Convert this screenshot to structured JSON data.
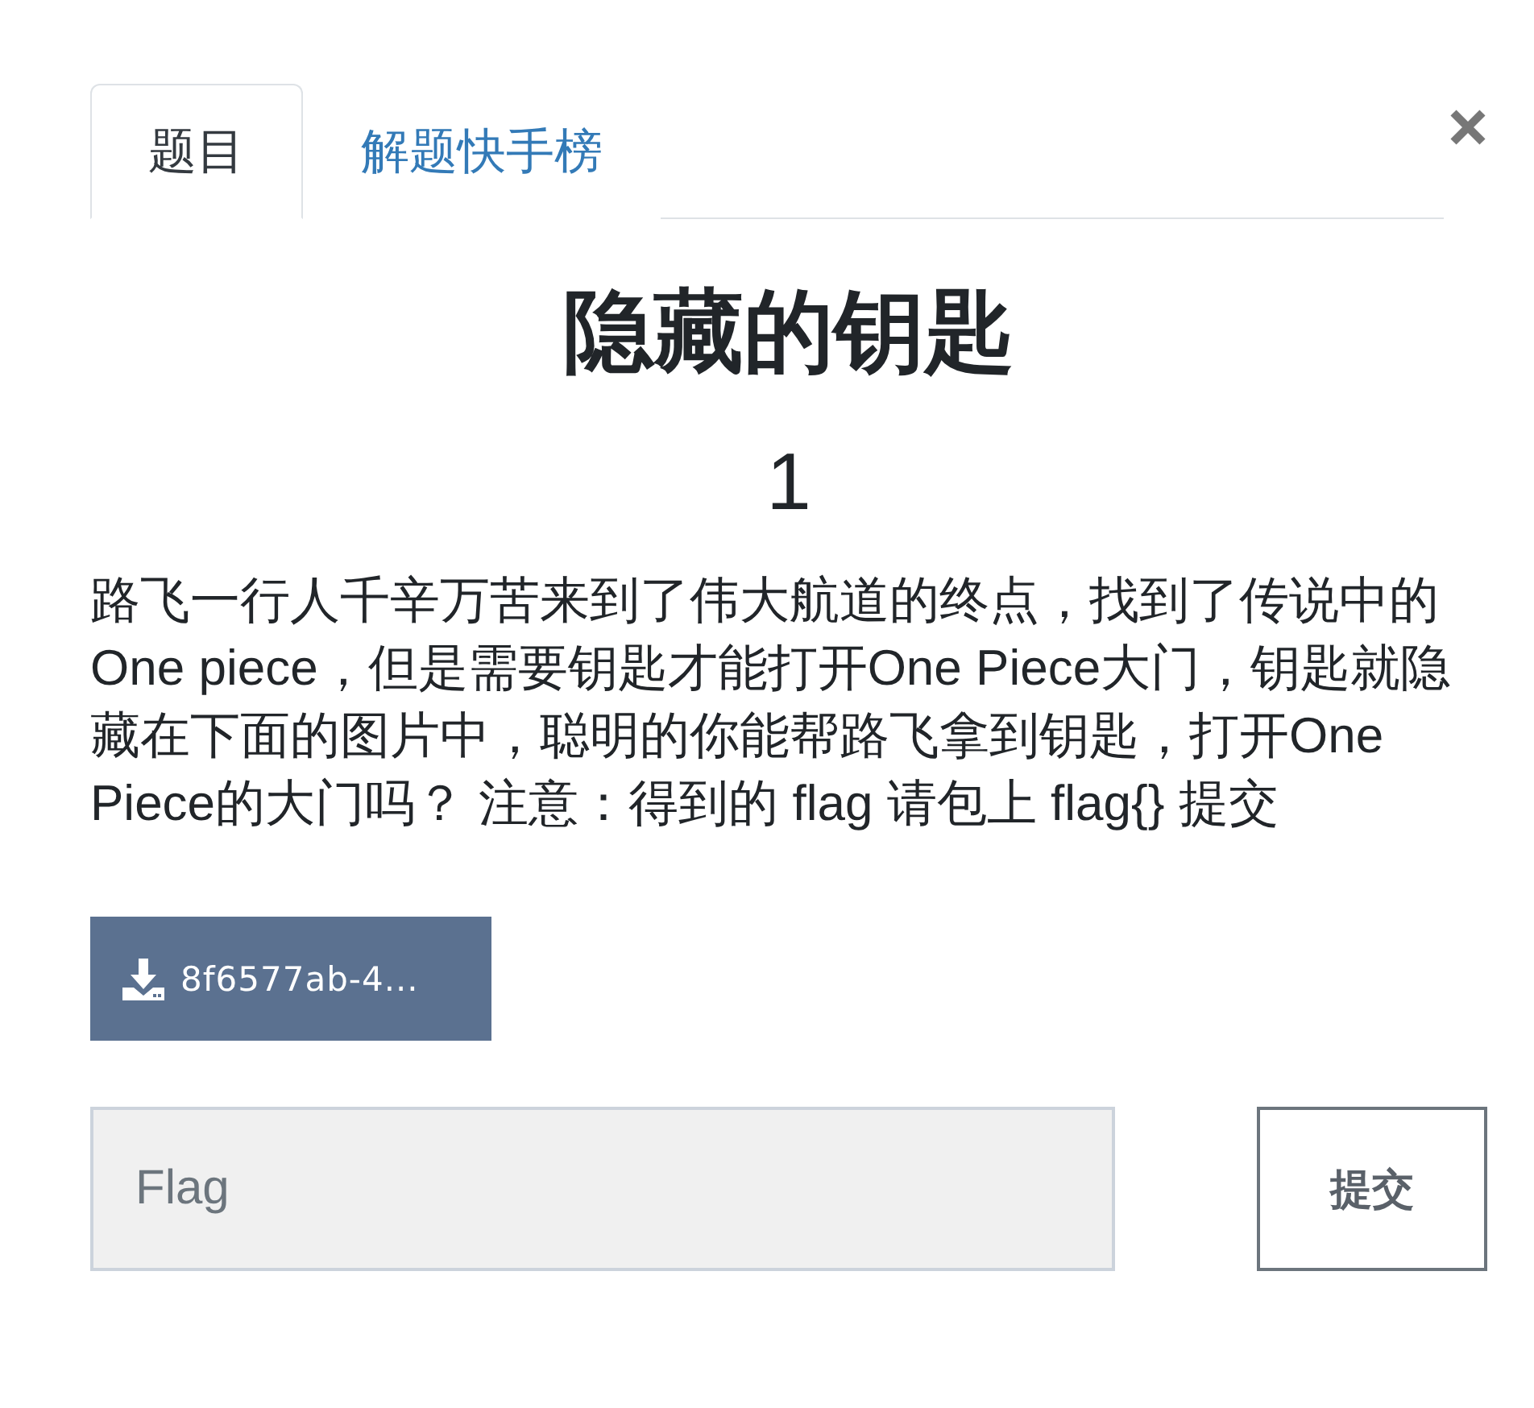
{
  "tabs": [
    {
      "label": "题目",
      "selected": true
    },
    {
      "label": "解题快手榜",
      "selected": false
    }
  ],
  "challenge": {
    "title": "隐藏的钥匙",
    "points": "1",
    "description": "路飞一行人千辛万苦来到了伟大航道的终点，找到了传说中的One piece，但是需要钥匙才能打开One Piece大门，钥匙就隐藏在下面的图片中，聪明的你能帮路飞拿到钥匙，打开One Piece的大门吗？ 注意：得到的 flag 请包上 flag{} 提交",
    "attachment": {
      "label": "8f6577ab-4..."
    }
  },
  "flag_form": {
    "input": {
      "placeholder": "Flag"
    },
    "submit": {
      "label": "提交"
    }
  }
}
